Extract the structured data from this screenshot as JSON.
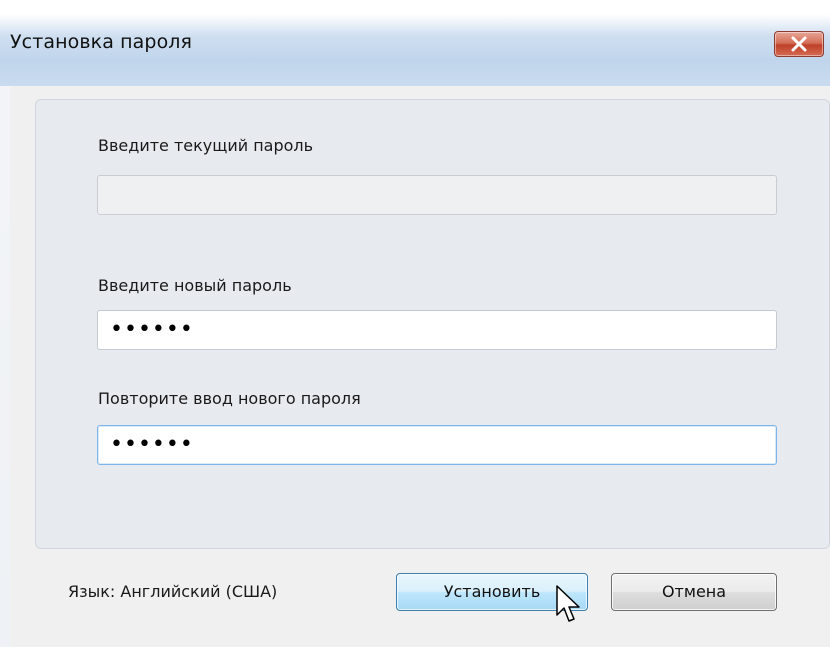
{
  "window": {
    "title": "Установка пароля",
    "close_icon": "close-icon"
  },
  "form": {
    "current_password_label": "Введите текущий пароль",
    "current_password_value": "",
    "new_password_label": "Введите новый пароль",
    "new_password_value": "••••••",
    "repeat_password_label": "Повторите ввод нового пароля",
    "repeat_password_value": "••••••"
  },
  "footer": {
    "language": "Язык: Английский (США)",
    "set_label": "Установить",
    "cancel_label": "Отмена"
  },
  "colors": {
    "close_button": "#c7462f",
    "default_button_border": "#3c7fb1",
    "focus_border": "#7eb4ea"
  }
}
